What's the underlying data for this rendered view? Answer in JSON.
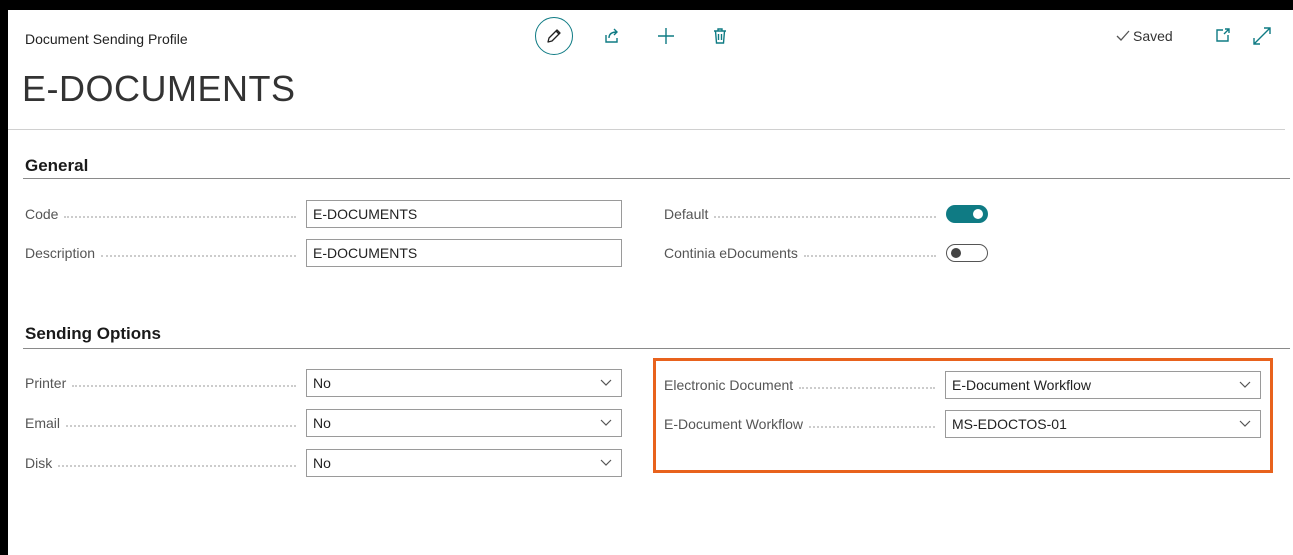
{
  "header": {
    "breadcrumb": "Document Sending Profile",
    "page_title": "E-DOCUMENTS",
    "saved_label": "Saved"
  },
  "icons": [
    "edit-icon",
    "share-icon",
    "plus-icon",
    "trash-icon",
    "check-icon",
    "popout-icon",
    "expand-icon",
    "chevron-down-icon"
  ],
  "colors": {
    "accent": "#0f7b84",
    "highlight": "#e8621d"
  },
  "general": {
    "title": "General",
    "code_label": "Code",
    "code_value": "E-DOCUMENTS",
    "description_label": "Description",
    "description_value": "E-DOCUMENTS",
    "default_label": "Default",
    "default_on": true,
    "continia_label": "Continia eDocuments",
    "continia_on": false
  },
  "sending_options": {
    "title": "Sending Options",
    "printer_label": "Printer",
    "printer_value": "No",
    "email_label": "Email",
    "email_value": "No",
    "disk_label": "Disk",
    "disk_value": "No",
    "electronic_document_label": "Electronic Document",
    "electronic_document_value": "E-Document Workflow",
    "edocument_workflow_label": "E-Document Workflow",
    "edocument_workflow_value": "MS-EDOCTOS-01"
  }
}
